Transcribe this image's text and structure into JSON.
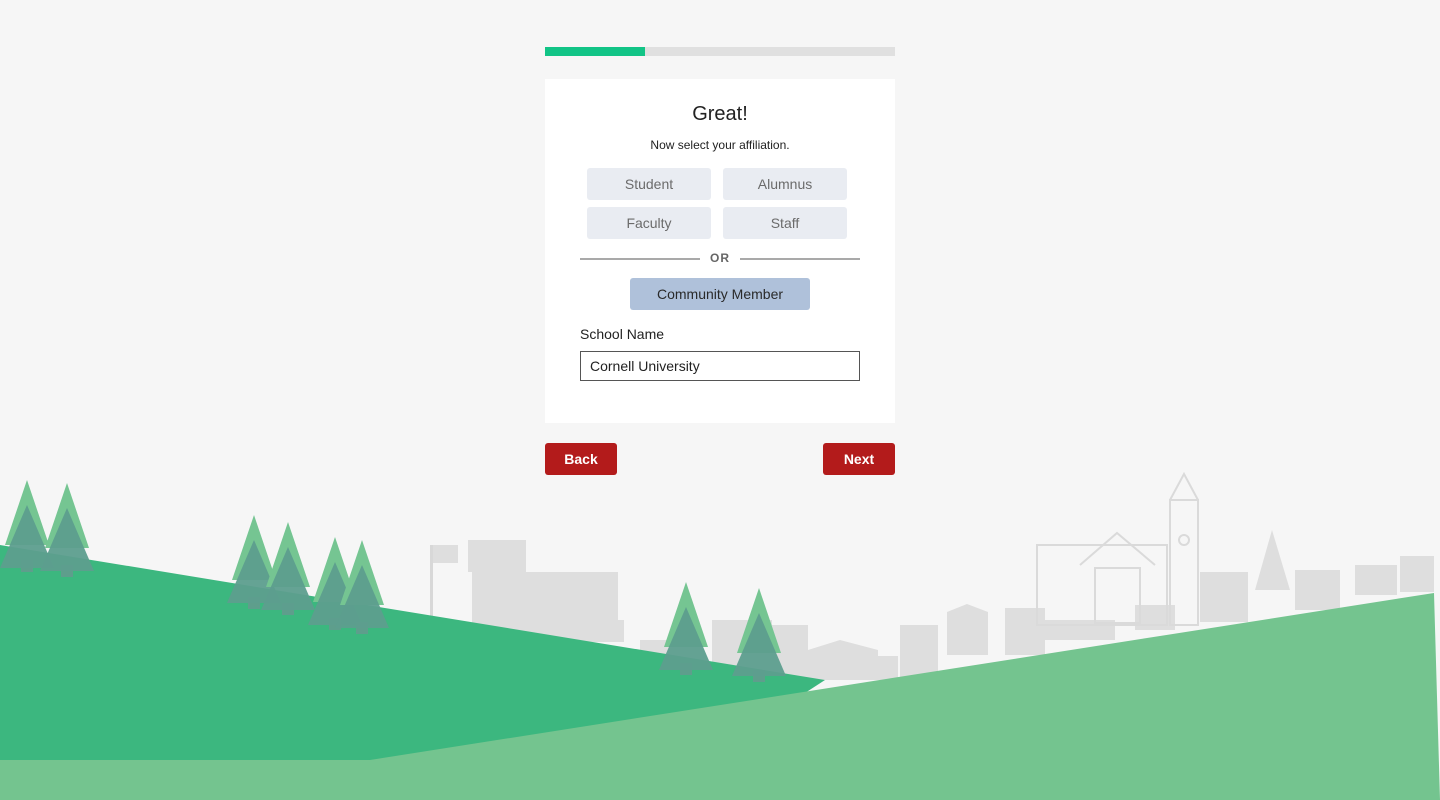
{
  "progress": {
    "fraction": 0.2857
  },
  "card": {
    "title": "Great!",
    "subtitle": "Now select your affiliation.",
    "options": [
      "Student",
      "Alumnus",
      "Faculty",
      "Staff"
    ],
    "divider_text": "OR",
    "community_label": "Community Member",
    "field_label": "School Name",
    "field_value": "Cornell University"
  },
  "nav": {
    "back_label": "Back",
    "next_label": "Next"
  },
  "colors": {
    "accent_green": "#12c486",
    "button_red": "#b31b1b",
    "option_bg": "#e9ecf2",
    "community_bg": "#afc1da",
    "hill_dark": "#3cb77f",
    "hill_light": "#74c48f",
    "skyline": "#dedede"
  }
}
